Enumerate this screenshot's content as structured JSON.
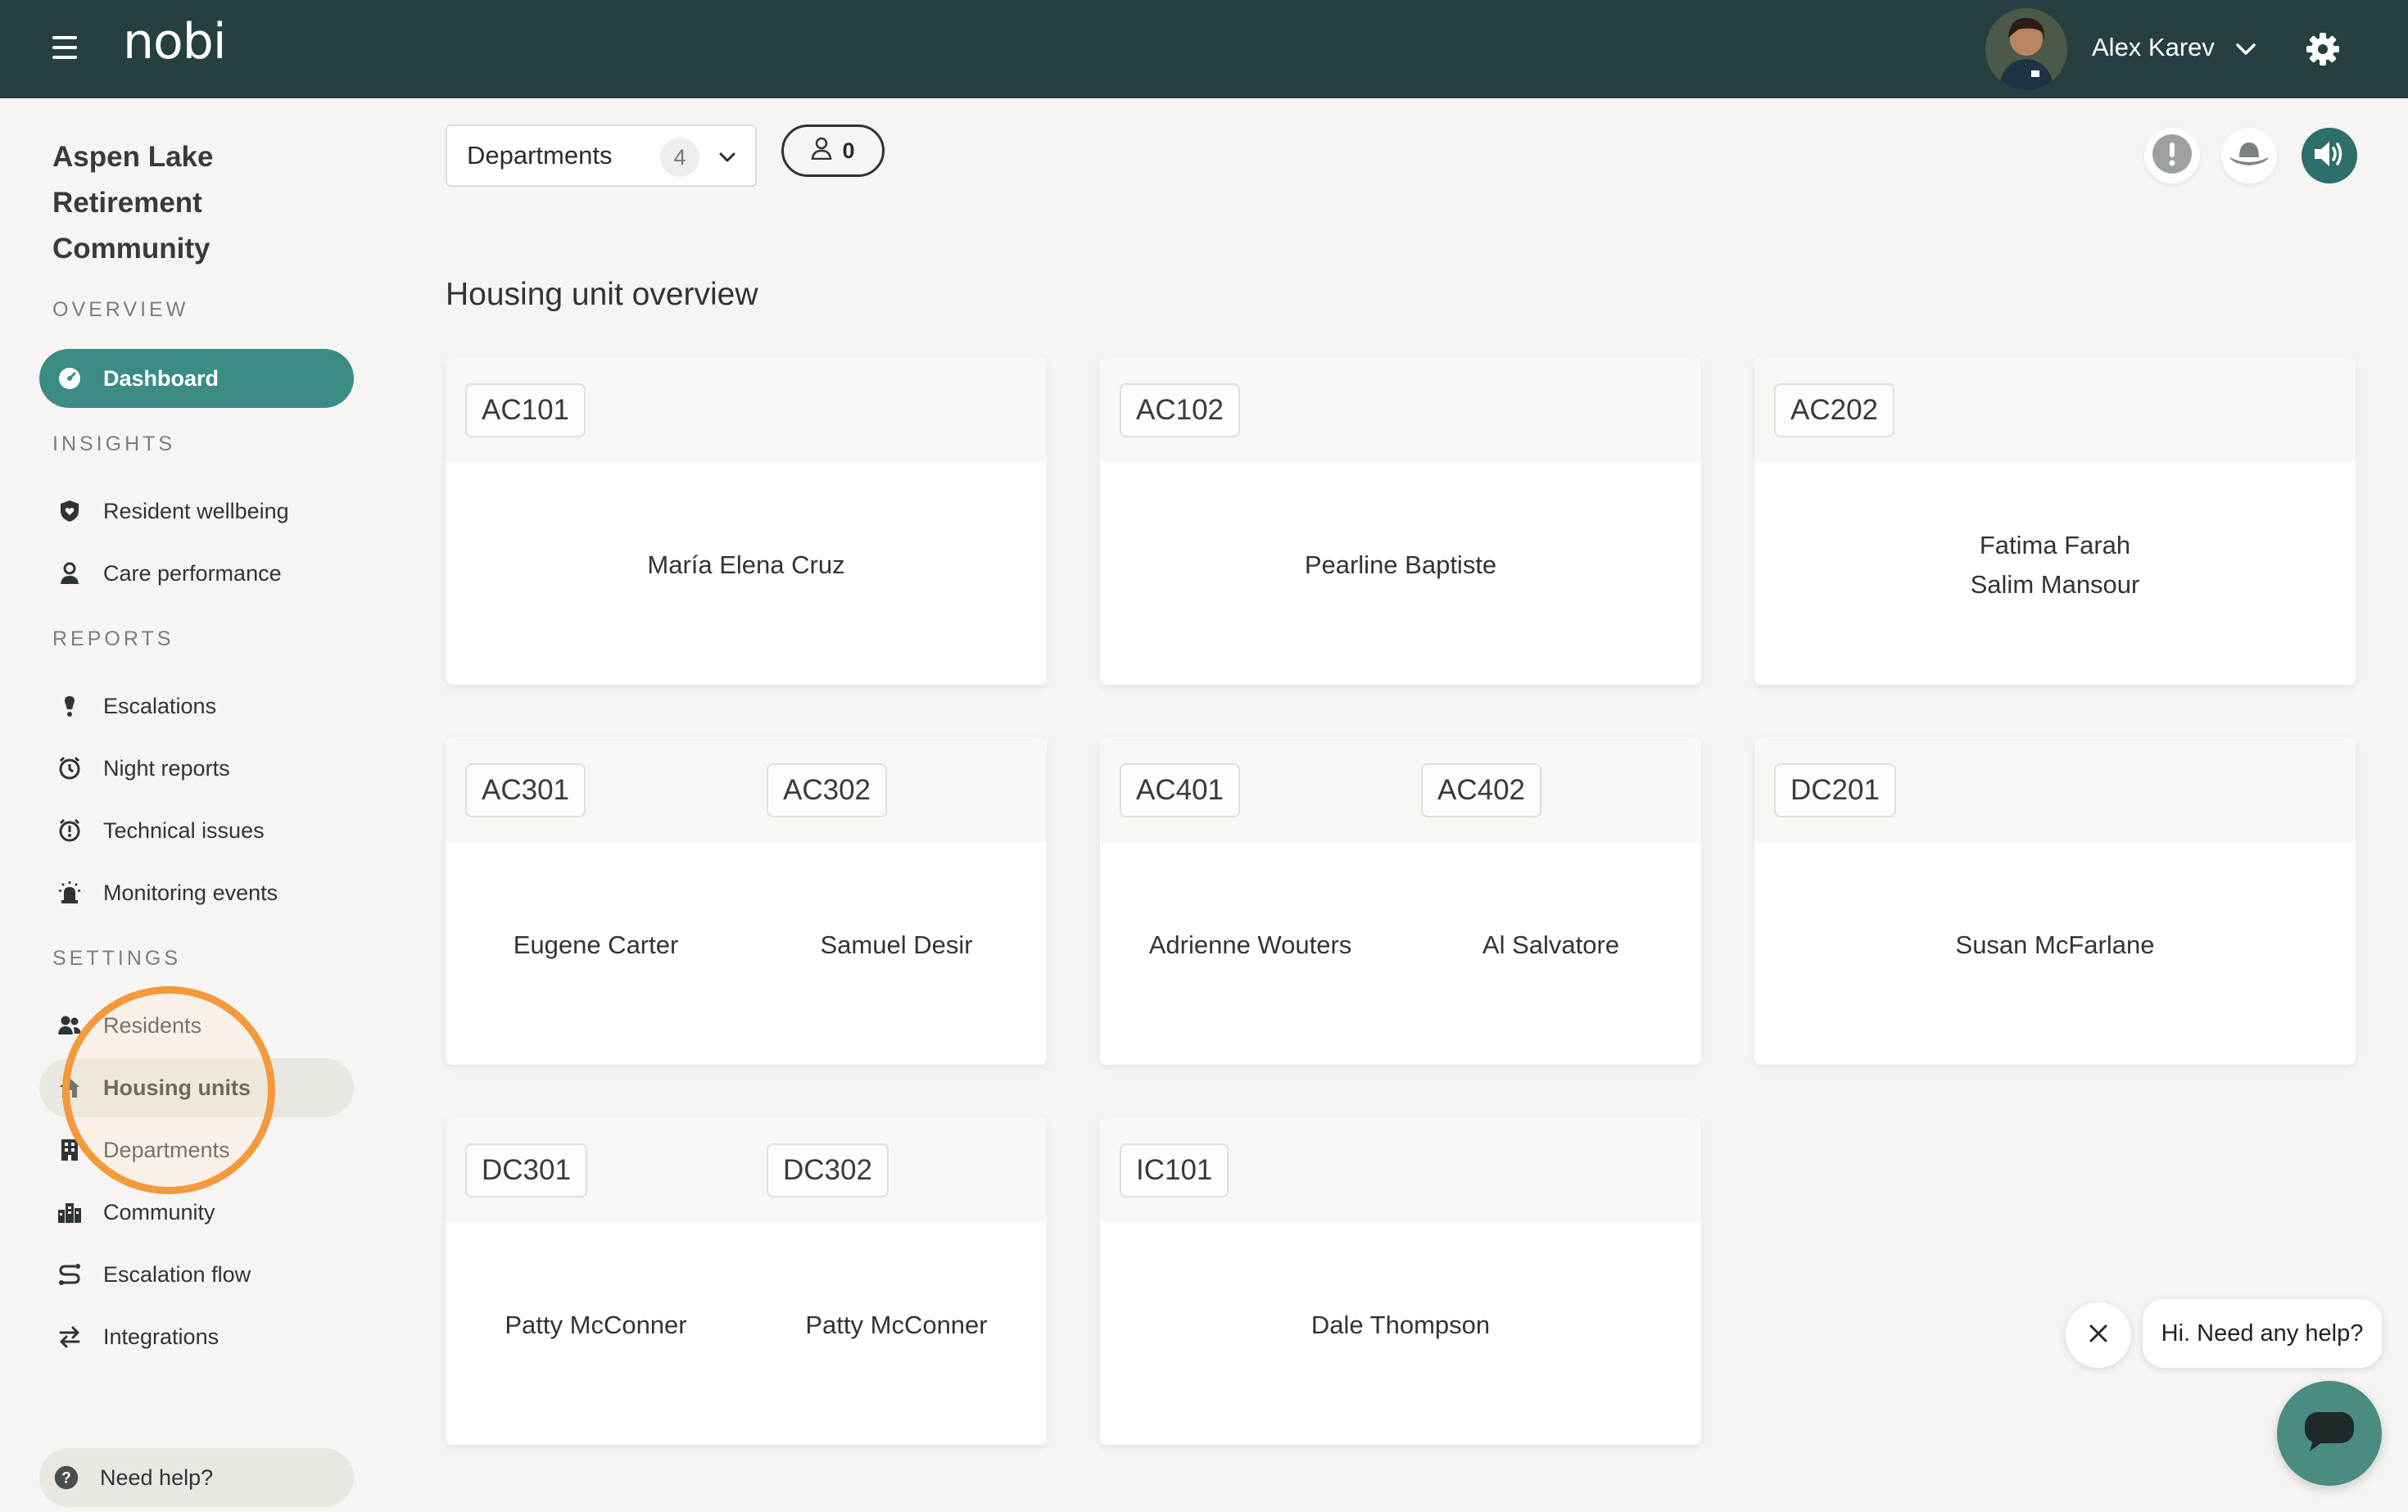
{
  "app": {
    "logo": "nobi"
  },
  "user": {
    "name": "Alex Karev"
  },
  "sidebar": {
    "org_name": "Aspen Lake Retirement Community",
    "sections": {
      "overview": "OVERVIEW",
      "insights": "INSIGHTS",
      "reports": "REPORTS",
      "settings": "SETTINGS"
    },
    "items": {
      "dashboard": "Dashboard",
      "resident_wellbeing": "Resident wellbeing",
      "care_performance": "Care performance",
      "escalations": "Escalations",
      "night_reports": "Night reports",
      "technical_issues": "Technical issues",
      "monitoring_events": "Monitoring events",
      "residents": "Residents",
      "housing_units": "Housing units",
      "departments": "Departments",
      "community": "Community",
      "escalation_flow": "Escalation flow",
      "integrations": "Integrations"
    },
    "help": "Need help?"
  },
  "toolbar": {
    "departments_label": "Departments",
    "departments_count": "4",
    "staff_count": "0"
  },
  "main": {
    "title": "Housing unit overview",
    "cards": [
      {
        "units": [
          "AC101"
        ],
        "residents": [
          [
            "María Elena Cruz"
          ]
        ]
      },
      {
        "units": [
          "AC102"
        ],
        "residents": [
          [
            "Pearline Baptiste"
          ]
        ]
      },
      {
        "units": [
          "AC202"
        ],
        "residents": [
          [
            "Fatima Farah",
            "Salim Mansour"
          ]
        ]
      },
      {
        "units": [
          "AC301",
          "AC302"
        ],
        "residents": [
          [
            "Eugene Carter"
          ],
          [
            "Samuel Desir"
          ]
        ]
      },
      {
        "units": [
          "AC401",
          "AC402"
        ],
        "residents": [
          [
            "Adrienne Wouters"
          ],
          [
            "Al Salvatore"
          ]
        ]
      },
      {
        "units": [
          "DC201"
        ],
        "residents": [
          [
            "Susan McFarlane"
          ]
        ]
      },
      {
        "units": [
          "DC301",
          "DC302"
        ],
        "residents": [
          [
            "Patty McConner"
          ],
          [
            "Patty McConner"
          ]
        ]
      },
      {
        "units": [
          "IC101"
        ],
        "residents": [
          [
            "Dale Thompson"
          ]
        ]
      }
    ]
  },
  "chat": {
    "greeting": "Hi. Need any help?"
  },
  "colors": {
    "topbar": "#263f40",
    "accent": "#3a8c84",
    "highlight": "#f39a3c"
  }
}
